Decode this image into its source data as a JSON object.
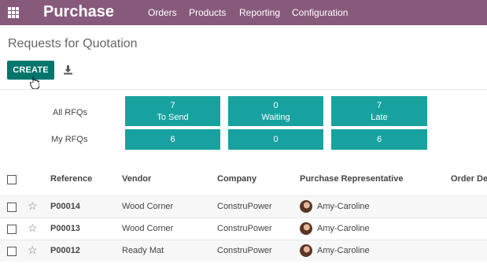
{
  "navbar": {
    "brand": "Purchase",
    "menu": [
      "Orders",
      "Products",
      "Reporting",
      "Configuration"
    ]
  },
  "page": {
    "title": "Requests for Quotation",
    "create_label": "CREATE"
  },
  "dashboard": {
    "rows": [
      {
        "label": "All RFQs",
        "tiles": [
          {
            "value": "7",
            "label": "To Send"
          },
          {
            "value": "0",
            "label": "Waiting"
          },
          {
            "value": "7",
            "label": "Late"
          }
        ]
      },
      {
        "label": "My RFQs",
        "tiles": [
          {
            "value": "6"
          },
          {
            "value": "0"
          },
          {
            "value": "6"
          }
        ]
      }
    ]
  },
  "table": {
    "columns": [
      "Reference",
      "Vendor",
      "Company",
      "Purchase Representative",
      "Order De"
    ],
    "rows": [
      {
        "reference": "P00014",
        "vendor": "Wood Corner",
        "company": "ConstruPower",
        "representative": "Amy-Caroline"
      },
      {
        "reference": "P00013",
        "vendor": "Wood Corner",
        "company": "ConstruPower",
        "representative": "Amy-Caroline"
      },
      {
        "reference": "P00012",
        "vendor": "Ready Mat",
        "company": "ConstruPower",
        "representative": "Amy-Caroline"
      }
    ]
  },
  "colors": {
    "navbar": "#875a7b",
    "create_button": "#00756c",
    "tile": "#17a2a0"
  }
}
